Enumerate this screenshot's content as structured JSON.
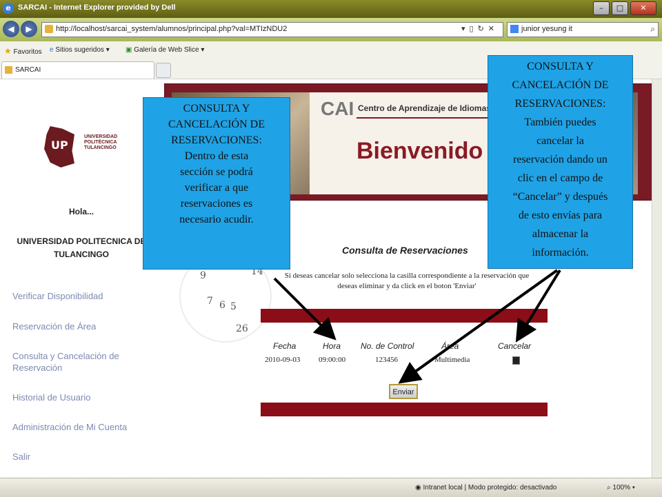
{
  "window": {
    "title": "SARCAI - Internet Explorer provided by Dell",
    "controls": {
      "minimize": "–",
      "maximize": "□",
      "close": "✕"
    }
  },
  "address_bar": {
    "url": "http://localhost/sarcai_system/alumnos/principal.php?val=MTIzNDU2",
    "search_text": "junior yesung it"
  },
  "favorites_bar": {
    "favorites_label": "Favoritos",
    "suggested_sites": "Sitios sugeridos",
    "web_slice_gallery": "Galería de Web Slice"
  },
  "tab": {
    "label": "SARCAI"
  },
  "sidebar": {
    "logo_text": [
      "UNIVERSIDAD",
      "POLITÉCNICA",
      "TULANCINGO"
    ],
    "greeting": "Hola...",
    "user_name": [
      "UNIVERSIDAD POLITECNICA DE",
      "TULANCINGO"
    ],
    "menu": [
      [
        "Verificar Disponibilidad"
      ],
      [
        "Reservación de Área"
      ],
      [
        "Consulta y Cancelación de",
        "Reservación"
      ],
      [
        "Historial de Usuario"
      ],
      [
        "Administración de Mi Cuenta"
      ],
      [
        "Salir"
      ]
    ]
  },
  "banner": {
    "cai": "CAI",
    "cai_subtitle": "Centro de Aprendizaje de Idiomas",
    "welcome": "Bienvenido"
  },
  "clock_numbers": [
    "14",
    "9",
    "7",
    "6",
    "5",
    "26"
  ],
  "main": {
    "title": "Consulta de Reservaciones",
    "instructions": "Si deseas cancelar solo selecciona la casilla correspondiente a la reservación que deseas eliminar y da click en el boton 'Enviar'",
    "table": {
      "headers": [
        "Fecha",
        "Hora",
        "No. de Control",
        "Área",
        "Cancelar"
      ],
      "rows": [
        {
          "fecha": "2010-09-03",
          "hora": "09:00:00",
          "control": "123456",
          "area": "Multimedia"
        }
      ]
    },
    "submit_label": "Enviar"
  },
  "callout_left": {
    "lines": [
      "CONSULTA Y",
      "CANCELACIÓN DE",
      "RESERVACIONES:",
      "Dentro de esta",
      "sección se podrá",
      "verificar a que",
      "reservaciones es",
      "necesario acudir."
    ]
  },
  "callout_right": {
    "lines": [
      "CONSULTA Y",
      "CANCELACIÓN DE",
      "RESERVACIONES:",
      "También puedes",
      "cancelar la",
      "reservación dando un",
      "clic en el campo de",
      "“Cancelar” y después",
      "de esto envías para",
      "almacenar la",
      "información."
    ]
  },
  "status_bar": {
    "zone": "Intranet local | Modo protegido: desactivado",
    "zoom": "100%"
  },
  "colors": {
    "accent_red": "#8b0d17",
    "callout_blue": "#1fa3e6",
    "menu_link": "#7d8ab2"
  }
}
